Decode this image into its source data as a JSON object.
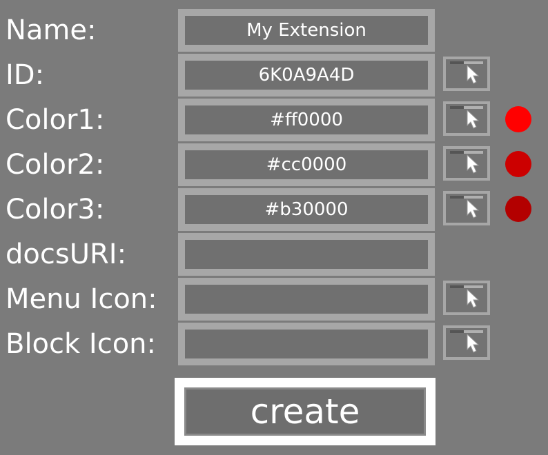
{
  "form": {
    "rows": [
      {
        "label": "Name:",
        "value": "My Extension",
        "placeholder": ""
      },
      {
        "label": "ID:",
        "value": "6K0A9A4D",
        "placeholder": ""
      },
      {
        "label": "Color1:",
        "value": "#ff0000",
        "placeholder": "",
        "swatch": "#ff0000"
      },
      {
        "label": "Color2:",
        "value": "#cc0000",
        "placeholder": "",
        "swatch": "#cc0000"
      },
      {
        "label": "Color3:",
        "value": "#b30000",
        "placeholder": "",
        "swatch": "#b30000"
      },
      {
        "label": "docsURI:",
        "value": "",
        "placeholder": ""
      },
      {
        "label": "Menu Icon:",
        "value": "",
        "placeholder": ""
      },
      {
        "label": "Block Icon:",
        "value": "",
        "placeholder": ""
      }
    ]
  },
  "create_button": {
    "label": "create"
  },
  "icons": {
    "picker": "cursor-picker-icon"
  },
  "colors": {
    "background": "#7b7b7b",
    "field_border": "#a7a7a7",
    "field_fill": "#707070",
    "button_border": "#ffffff"
  }
}
